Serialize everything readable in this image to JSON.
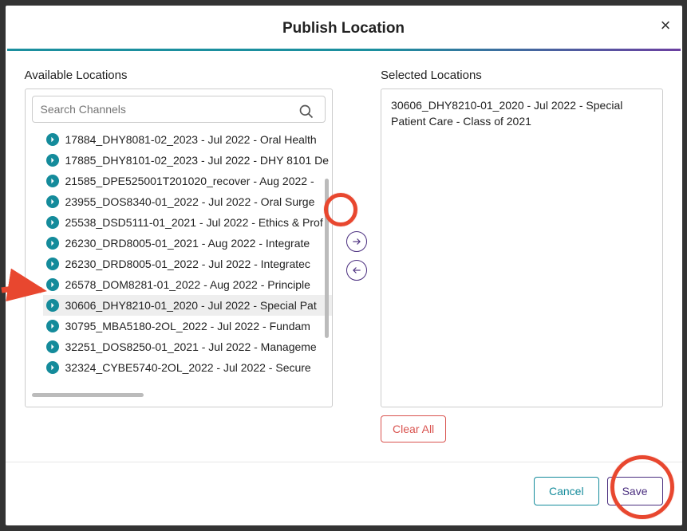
{
  "modal": {
    "title": "Publish Location",
    "close_glyph": "×"
  },
  "available": {
    "heading": "Available Locations",
    "search_placeholder": "Search Channels",
    "items": [
      "17884_DHY8081-02_2023 - Jul 2022 - Oral Health",
      "17885_DHY8101-02_2023 - Jul 2022 - DHY 8101 De",
      "21585_DPE525001T201020_recover - Aug 2022 -",
      "23955_DOS8340-01_2022 - Jul 2022 - Oral Surge",
      "25538_DSD5111-01_2021 - Jul 2022 - Ethics & Prof",
      "26230_DRD8005-01_2021 - Aug 2022 - Integrate",
      "26230_DRD8005-01_2022 - Jul 2022 - Integratec",
      "26578_DOM8281-01_2022 - Aug 2022 - Principle",
      "30606_DHY8210-01_2020 - Jul 2022 - Special Pat",
      "30795_MBA5180-2OL_2022 - Jul 2022 - Fundam",
      "32251_DOS8250-01_2021 - Jul 2022 - Manageme",
      "32324_CYBE5740-2OL_2022 - Jul 2022 - Secure"
    ],
    "highlight_index": 8
  },
  "selected": {
    "heading": "Selected Locations",
    "items": [
      "30606_DHY8210-01_2020 - Jul 2022 - Special Patient Care - Class of 2021"
    ]
  },
  "buttons": {
    "clear_all": "Clear All",
    "cancel": "Cancel",
    "save": "Save"
  }
}
